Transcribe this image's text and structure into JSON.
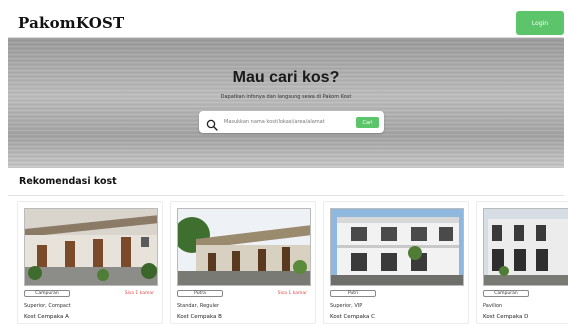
{
  "header": {
    "brand": "PakomKOST",
    "login_label": "Login"
  },
  "hero": {
    "title": "Mau cari kos?",
    "subtitle": "Dapatkan infonya dan langsung sewa di Pakom Kost",
    "search_placeholder": "Masukkan nama kost/lokasi/area/alamat",
    "search_button": "Cari"
  },
  "section": {
    "title": "Rekomendasi kost"
  },
  "cards": [
    {
      "type": "Campuran",
      "availability": "Sisa 1 kamar",
      "category": "Superior, Compact",
      "name": "Kost Cempaka A"
    },
    {
      "type": "Putra",
      "availability": "Sisa 1 kamar",
      "category": "Standar, Reguler",
      "name": "Kost Cempaka B"
    },
    {
      "type": "Putri",
      "availability": "",
      "category": "Superior, VIP",
      "name": "Kost Cempaka C"
    },
    {
      "type": "Campuran",
      "availability": "",
      "category": "Pavilion",
      "name": "Kost Cempaka D"
    }
  ],
  "colors": {
    "accent_green": "#5cc46a",
    "availability_red": "#e04747"
  }
}
